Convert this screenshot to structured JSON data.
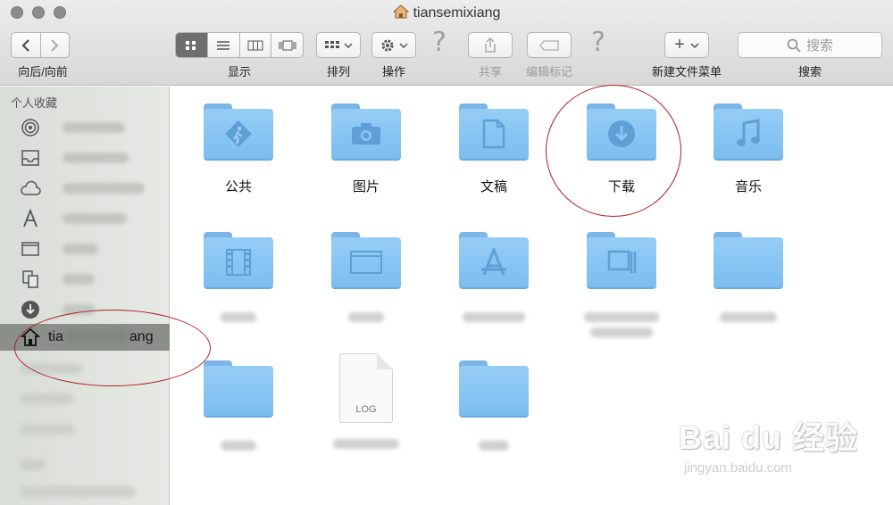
{
  "window": {
    "title": "tiansemixiang"
  },
  "toolbar": {
    "nav_label": "向后/向前",
    "view_label": "显示",
    "sort_label": "排列",
    "action_label": "操作",
    "share_label": "共享",
    "tags_label": "编辑标记",
    "new_menu_label": "新建文件菜单",
    "search_label": "搜索",
    "search_placeholder": "搜索",
    "new_button_glyph": "+"
  },
  "sidebar": {
    "header": "个人收藏",
    "selected_item": "tiansemixiang",
    "selected_visible_text_prefix": "tia",
    "selected_visible_text_suffix": "ang"
  },
  "content": {
    "folders": [
      {
        "name": "公共",
        "icon": "public-folder-icon"
      },
      {
        "name": "图片",
        "icon": "pictures-folder-icon"
      },
      {
        "name": "文稿",
        "icon": "documents-folder-icon"
      },
      {
        "name": "下载",
        "icon": "downloads-folder-icon"
      },
      {
        "name": "音乐",
        "icon": "music-folder-icon"
      }
    ],
    "log_file_ext": "LOG"
  },
  "watermark": {
    "brand": "Bai du 经验",
    "url": "jingyan.baidu.com"
  },
  "colors": {
    "folder_blue": "#85c3f2",
    "annotation_red": "#b01e23",
    "sidebar_selected": "#8a8f8a"
  }
}
